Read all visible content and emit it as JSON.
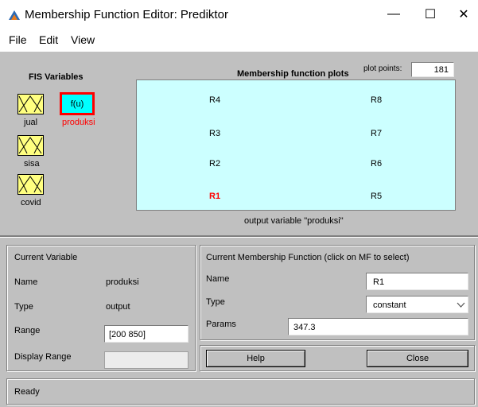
{
  "window": {
    "title": "Membership Function Editor: Prediktor",
    "minimize": "—",
    "maximize": "☐",
    "close": "✕"
  },
  "menu": {
    "file": "File",
    "edit": "Edit",
    "view": "View"
  },
  "fis": {
    "heading": "FIS Variables",
    "inputs": [
      {
        "label": "jual"
      },
      {
        "label": "sisa"
      },
      {
        "label": "covid"
      }
    ],
    "output": {
      "box_label": "f(u)",
      "label": "produksi"
    }
  },
  "plot": {
    "heading": "Membership function plots",
    "points_label": "plot points:",
    "points_value": "181",
    "caption": "output variable \"produksi\"",
    "mfs": [
      {
        "label": "R4",
        "selected": false
      },
      {
        "label": "R3",
        "selected": false
      },
      {
        "label": "R2",
        "selected": false
      },
      {
        "label": "R1",
        "selected": true
      },
      {
        "label": "R8",
        "selected": false
      },
      {
        "label": "R7",
        "selected": false
      },
      {
        "label": "R6",
        "selected": false
      },
      {
        "label": "R5",
        "selected": false
      }
    ]
  },
  "current_variable": {
    "heading": "Current Variable",
    "name_label": "Name",
    "name_value": "produksi",
    "type_label": "Type",
    "type_value": "output",
    "range_label": "Range",
    "range_value": "[200 850]",
    "display_range_label": "Display Range",
    "display_range_value": ""
  },
  "current_mf": {
    "heading": "Current Membership Function (click on MF to select)",
    "name_label": "Name",
    "name_value": "R1",
    "type_label": "Type",
    "type_value": "constant",
    "params_label": "Params",
    "params_value": "347.3"
  },
  "buttons": {
    "help": "Help",
    "close": "Close"
  },
  "status": "Ready",
  "colors": {
    "background": "#c0c0c0",
    "plot_area": "#ccffff",
    "input_box": "#ffff80",
    "output_box": "#00ffff",
    "selected": "#ff0000"
  }
}
